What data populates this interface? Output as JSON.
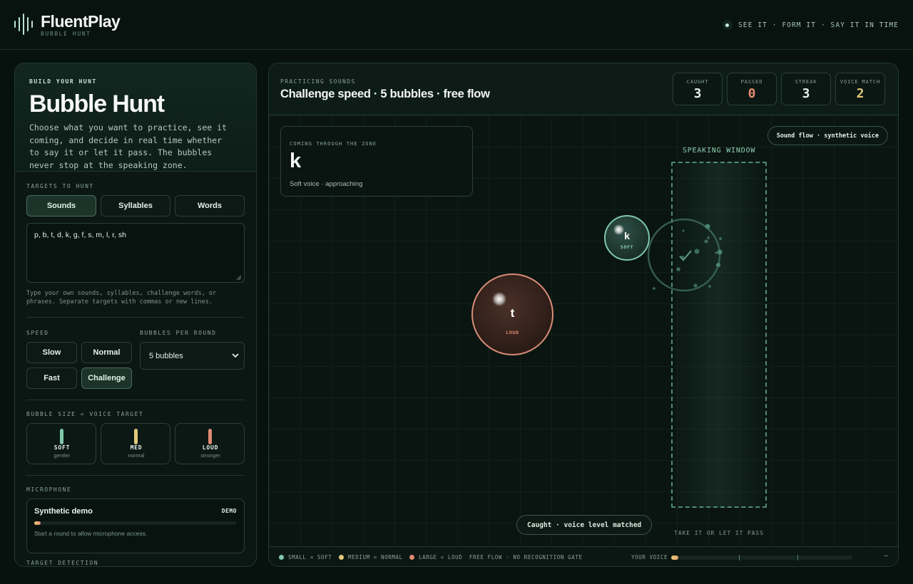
{
  "header": {
    "brand": "FluentPlay",
    "brand_sub": "BUBBLE HUNT",
    "tagline": "SEE IT · FORM IT · SAY IT IN TIME"
  },
  "build": {
    "kicker": "BUILD YOUR HUNT",
    "title": "Bubble Hunt",
    "description": "Choose what you want to practice, see it coming, and decide in real time whether to say it or let it pass. The bubbles never stop at the speaking zone."
  },
  "targets": {
    "label": "TARGETS TO HUNT",
    "modes": [
      "Sounds",
      "Syllables",
      "Words"
    ],
    "active_mode": "Sounds",
    "value": "p, b, t, d, k, g, f, s, m, l, r, sh",
    "help": "Type your own sounds, syllables, challenge words, or phrases. Separate targets with commas or new lines."
  },
  "speed": {
    "label": "SPEED",
    "options": [
      "Slow",
      "Normal",
      "Fast",
      "Challenge"
    ],
    "active": "Challenge"
  },
  "per_round": {
    "label": "BUBBLES PER ROUND",
    "selected": "5 bubbles"
  },
  "bubble_size": {
    "label": "BUBBLE SIZE = VOICE TARGET",
    "cards": [
      {
        "size": "SOFT",
        "sub": "gentler",
        "color": "#7fc8aa"
      },
      {
        "size": "MED",
        "sub": "normal",
        "color": "#e2c87a"
      },
      {
        "size": "LOUD",
        "sub": "stronger",
        "color": "#e08a74"
      }
    ]
  },
  "microphone": {
    "label": "MICROPHONE",
    "name": "Synthetic demo",
    "badge": "DEMO",
    "level_fraction": 0.03,
    "note": "Start a round to allow microphone access."
  },
  "detection": {
    "label": "TARGET DETECTION"
  },
  "practice": {
    "kicker": "PRACTICING SOUNDS",
    "title": "Challenge speed · 5 bubbles · free flow"
  },
  "stats": [
    {
      "label": "CAUGHT",
      "value": "3",
      "color": "#e6efe9"
    },
    {
      "label": "PASSED",
      "value": "0",
      "color": "#e88c6e"
    },
    {
      "label": "STREAK",
      "value": "3",
      "color": "#e6efe9"
    },
    {
      "label": "VOICE MATCH",
      "value": "2",
      "color": "#e2c87a"
    }
  ],
  "coming": {
    "label": "COMING THROUGH THE ZONE",
    "letter": "k",
    "status": "Soft voice · approaching"
  },
  "voice_pill": "Sound flow · synthetic voice",
  "window": {
    "label": "SPEAKING WINDOW",
    "sub": "TAKE IT OR LET IT PASS"
  },
  "bubbles": [
    {
      "letter": "k",
      "tag": "SOFT",
      "tag_color": "#8fd1b4"
    },
    {
      "letter": "t",
      "tag": "LOUD",
      "tag_color": "#e88c6e"
    }
  ],
  "caught_msg": "Caught · voice level matched",
  "footer": {
    "legend": [
      {
        "text": "SMALL = SOFT",
        "color": "#7fc8aa"
      },
      {
        "text": "MEDIUM = NORMAL",
        "color": "#e2c87a"
      },
      {
        "text": "LARGE = LOUD",
        "color": "#e08a74"
      }
    ],
    "mode_note": "FREE FLOW · NO RECOGNITION GATE",
    "your_voice_label": "YOUR VOICE",
    "your_voice_fraction": 0.04,
    "readout": "–"
  }
}
